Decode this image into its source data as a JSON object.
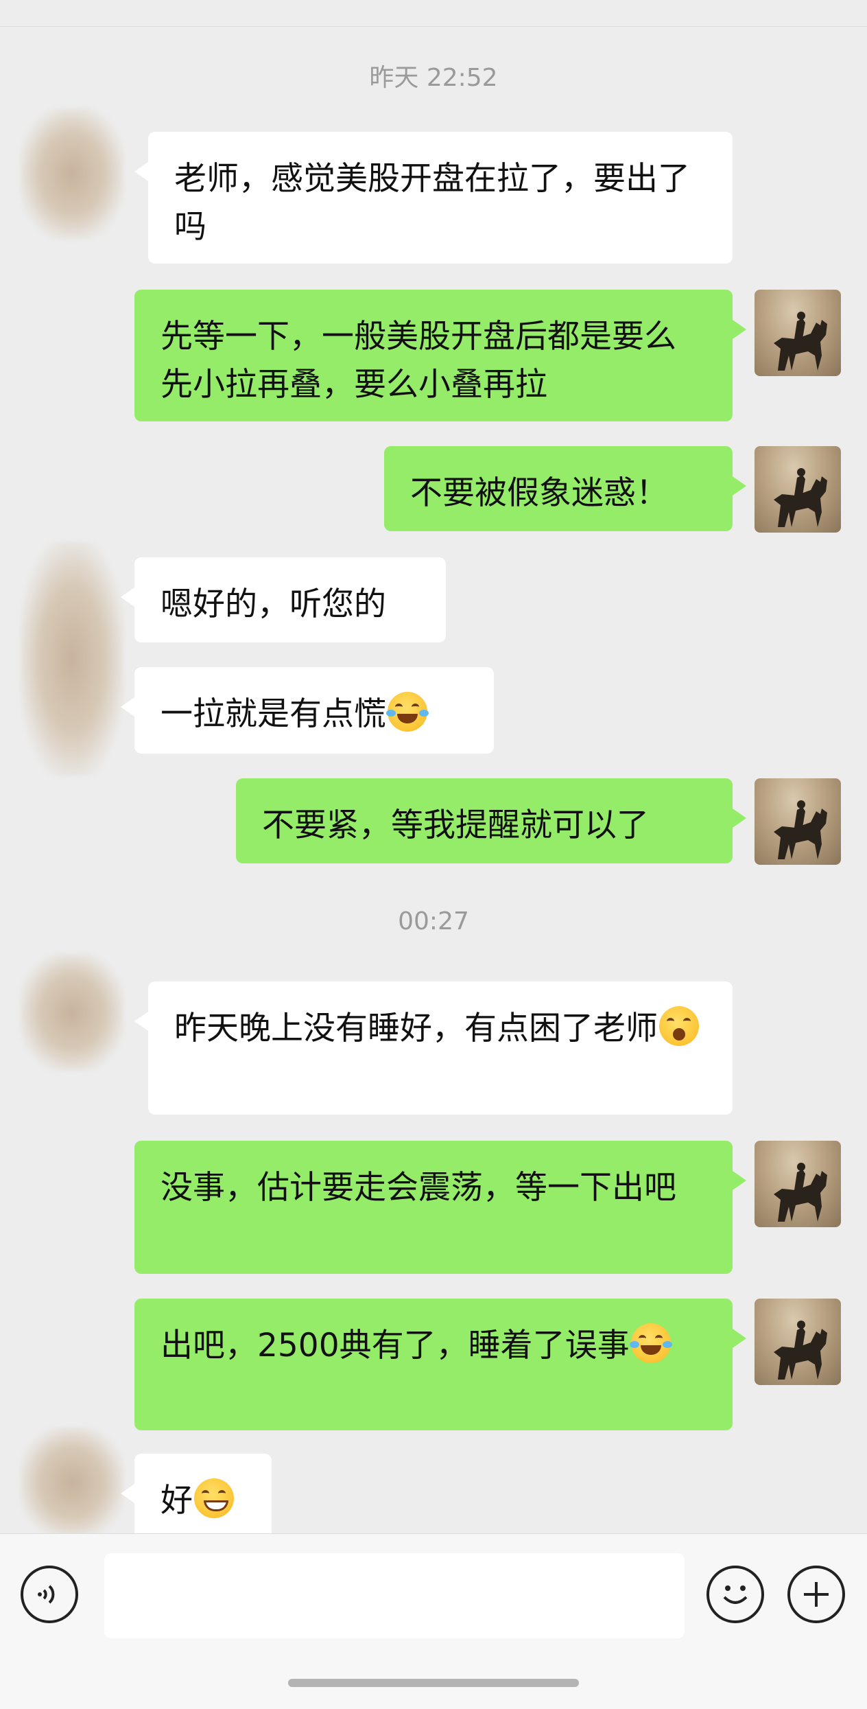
{
  "timestamps": {
    "first": "昨天 22:52",
    "second": "00:27"
  },
  "messages": {
    "m1": "老师，感觉美股开盘在拉了，要出了吗",
    "m2": "先等一下，一般美股开盘后都是要么先小拉再叠，要么小叠再拉",
    "m3": "不要被假象迷惑！",
    "m4": "嗯好的，听您的",
    "m5": "一拉就是有点慌",
    "m6": "不要紧，等我提醒就可以了",
    "m7": "昨天晚上没有睡好，有点困了老师",
    "m8": "没事，估计要走会震荡，等一下出吧",
    "m9": "出吧，2500典有了，睡着了误事",
    "m10": "好"
  },
  "emojis": {
    "m5": "crying-laughing-emoji",
    "m7": "yawning-emoji",
    "m9": "crying-laughing-emoji",
    "m10": "grinning-emoji"
  },
  "input": {
    "value": ""
  },
  "colors": {
    "background": "#ededed",
    "outgoing_bubble": "#95ec69",
    "incoming_bubble": "#ffffff",
    "timestamp_text": "#9a9a9a"
  },
  "icons": {
    "voice": "voice-icon",
    "emoji": "emoji-icon",
    "plus": "plus-icon"
  }
}
